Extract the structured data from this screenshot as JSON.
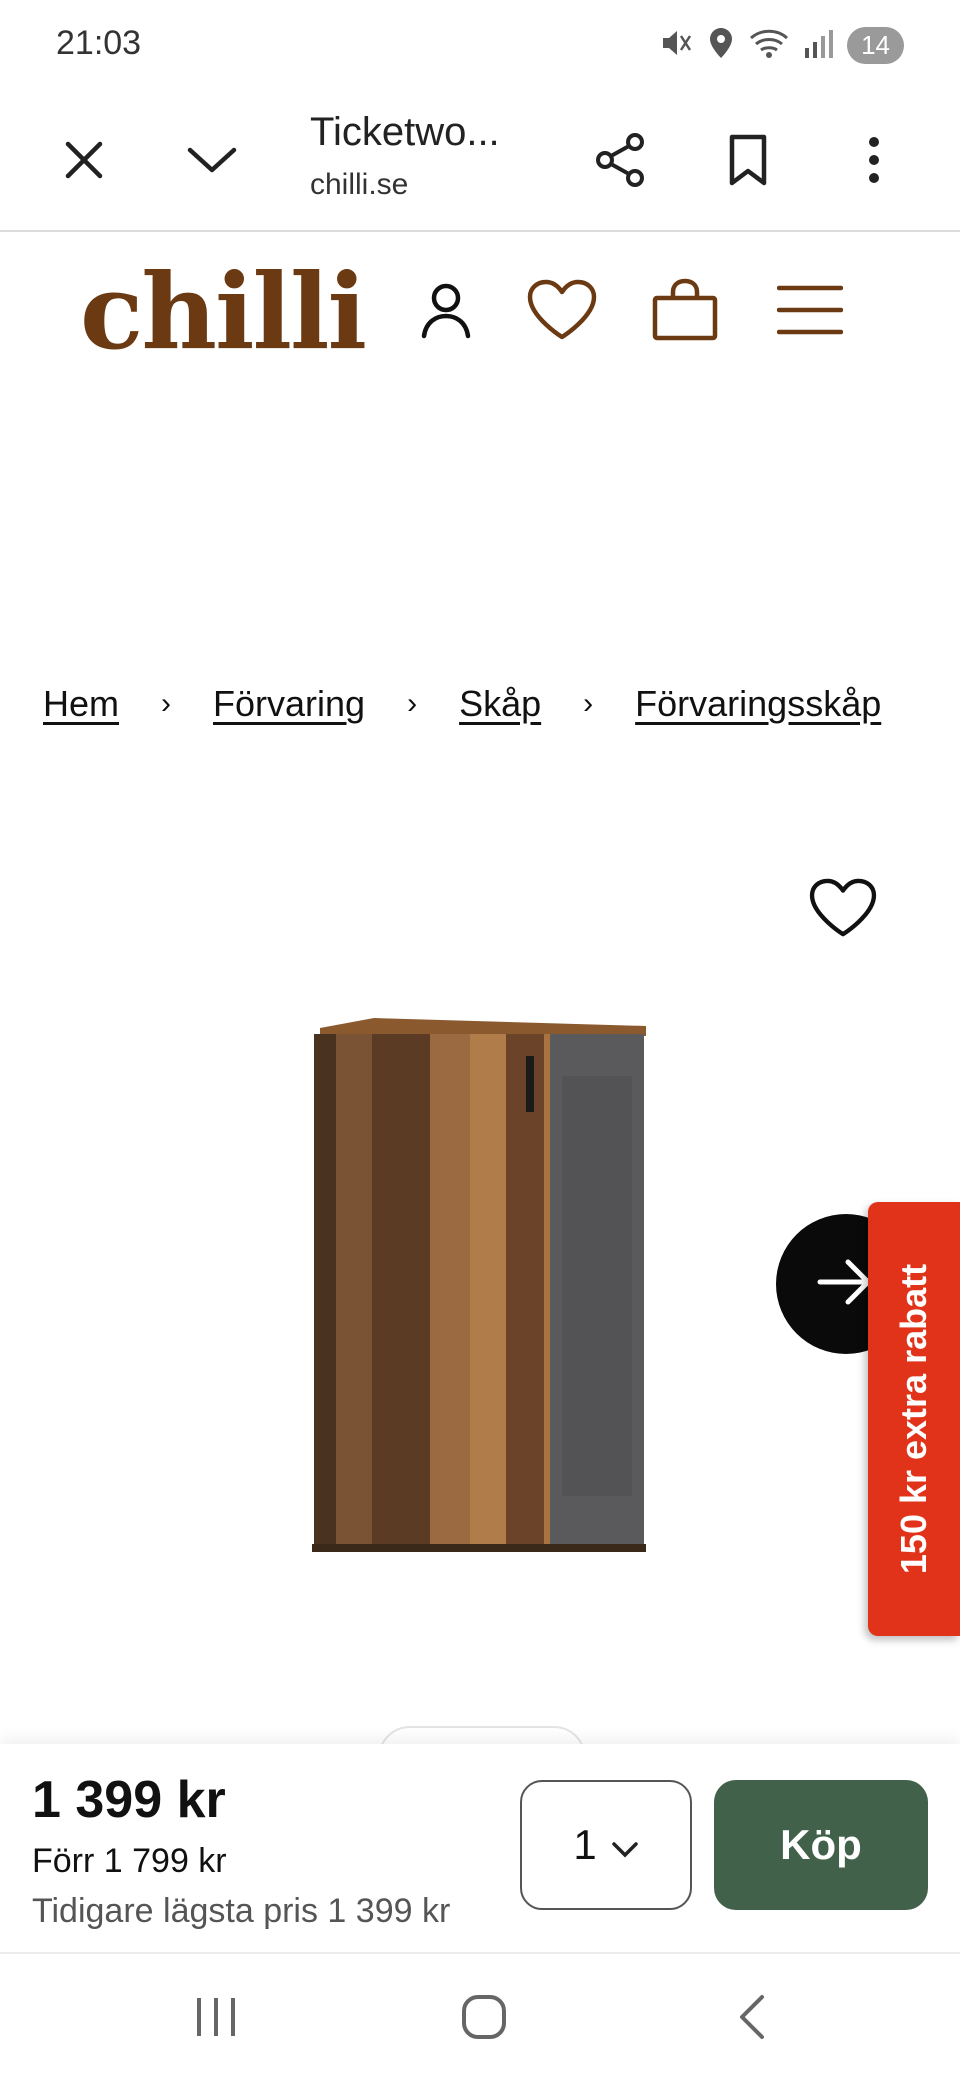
{
  "status_bar": {
    "time": "21:03",
    "icons": [
      "mute-icon",
      "location-icon",
      "wifi-icon",
      "signal-icon"
    ],
    "battery": "14"
  },
  "browser": {
    "title": "Ticketwo...",
    "url": "chilli.se",
    "icons": [
      "close-icon",
      "chevron-down-icon",
      "share-icon",
      "bookmark-icon",
      "more-icon"
    ]
  },
  "site_header": {
    "logo": "chilli",
    "brand_color": "#6b3a13",
    "icons": [
      "account-icon",
      "heart-icon",
      "cart-icon",
      "menu-icon"
    ]
  },
  "breadcrumb": [
    "Hem",
    "Förvaring",
    "Skåp",
    "Förvaringsskåp"
  ],
  "product": {
    "image": "storage-cabinet-wood-concrete",
    "promo_tab": "150 kr extra rabatt",
    "promo_color": "#e1321a"
  },
  "buy_bar": {
    "price": "1 399 kr",
    "before_price": "Förr 1 799 kr",
    "lowest_price": "Tidigare lägsta pris 1 399 kr",
    "quantity": "1",
    "buy_label": "Köp",
    "buy_color": "#42614a"
  },
  "nav_bar": {
    "icons": [
      "recents-icon",
      "home-icon",
      "back-icon"
    ]
  }
}
